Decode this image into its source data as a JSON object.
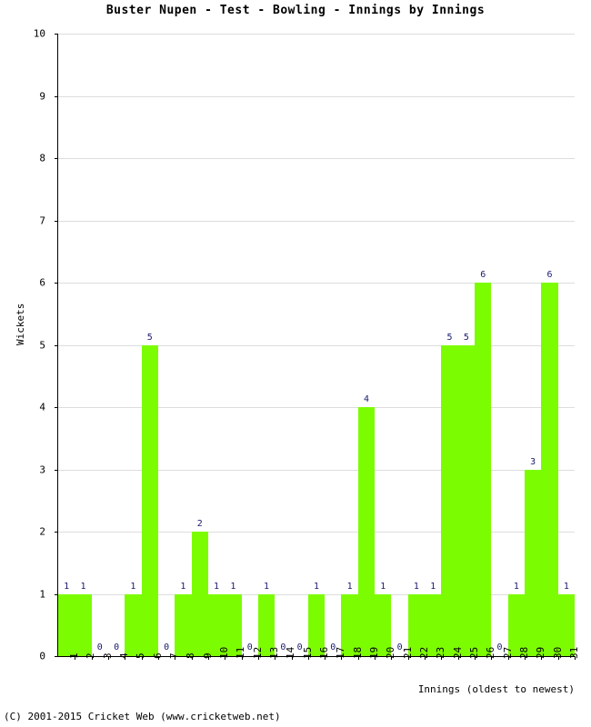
{
  "chart_data": {
    "type": "bar",
    "title": "Buster Nupen - Test - Bowling - Innings by Innings",
    "xlabel": "Innings (oldest to newest)",
    "ylabel": "Wickets",
    "ylim": [
      0,
      10
    ],
    "ytick_labels": [
      "0",
      "1",
      "2",
      "3",
      "4",
      "5",
      "6",
      "7",
      "8",
      "9",
      "10"
    ],
    "grid": true,
    "legend": "none",
    "bar_color": "#7CFC00",
    "value_label_color": "#191970",
    "categories": [
      "1",
      "2",
      "3",
      "4",
      "5",
      "6",
      "7",
      "8",
      "9",
      "10",
      "11",
      "12",
      "13",
      "14",
      "15",
      "16",
      "17",
      "18",
      "19",
      "20",
      "21",
      "22",
      "23",
      "24",
      "25",
      "26",
      "27",
      "28",
      "29",
      "30",
      "31"
    ],
    "values": [
      1,
      1,
      0,
      0,
      1,
      5,
      0,
      1,
      2,
      1,
      1,
      0,
      1,
      0,
      0,
      1,
      0,
      1,
      4,
      1,
      0,
      1,
      1,
      5,
      5,
      6,
      0,
      1,
      3,
      6,
      1
    ],
    "value_labels": [
      "1",
      "1",
      "0",
      "0",
      "1",
      "5",
      "0",
      "1",
      "2",
      "1",
      "1",
      "0",
      "1",
      "0",
      "0",
      "1",
      "0",
      "1",
      "4",
      "1",
      "0",
      "1",
      "1",
      "5",
      "5",
      "6",
      "0",
      "1",
      "3",
      "6",
      "1"
    ]
  },
  "footer": {
    "copyright": "(C) 2001-2015 Cricket Web (www.cricketweb.net)"
  }
}
